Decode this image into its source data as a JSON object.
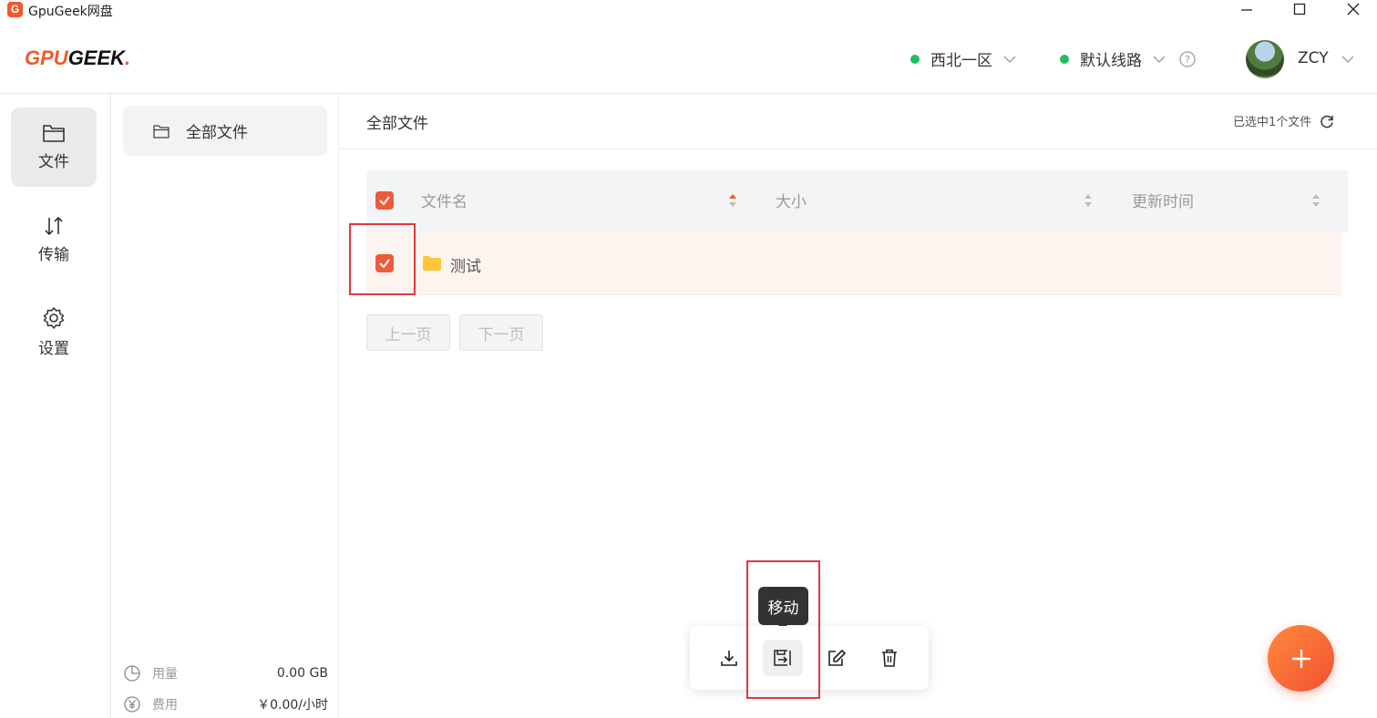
{
  "window": {
    "title": "GpuGeek网盘",
    "icon_letter": "G"
  },
  "header": {
    "logo_part1": "GPU",
    "logo_part2": "GEEK",
    "logo_dot": ".",
    "region": "西北一区",
    "route": "默认线路",
    "username": "ZCY"
  },
  "rail": {
    "items": [
      {
        "label": "文件",
        "icon": "folder-icon",
        "active": true
      },
      {
        "label": "传输",
        "icon": "transfer-icon",
        "active": false
      },
      {
        "label": "设置",
        "icon": "gear-icon",
        "active": false
      }
    ]
  },
  "folders": {
    "all_files": "全部文件",
    "usage_label": "用量",
    "usage_value": "0.00 GB",
    "cost_label": "费用",
    "cost_value": "￥0.00/小时"
  },
  "main": {
    "title": "全部文件",
    "selected_info": "已选中1个文件",
    "columns": [
      "文件名",
      "大小",
      "更新时间"
    ],
    "rows": [
      {
        "name": "测试",
        "type": "folder",
        "checked": true
      }
    ],
    "prev_page": "上一页",
    "next_page": "下一页"
  },
  "actions": {
    "tooltip": "移动",
    "items": [
      "download-icon",
      "move-icon",
      "rename-icon",
      "delete-icon"
    ]
  },
  "colors": {
    "accent": "#f05a28",
    "status_green": "#1fbf5f",
    "selected_row": "#fdf4f0"
  }
}
